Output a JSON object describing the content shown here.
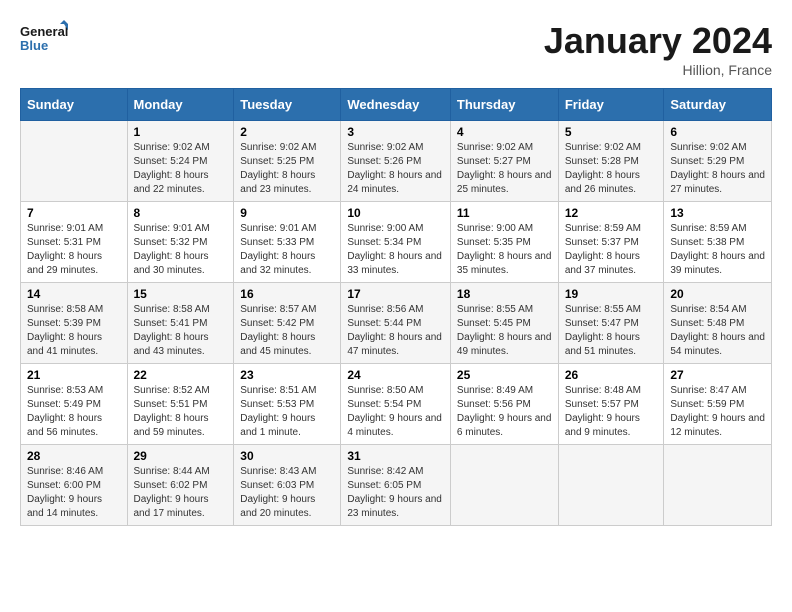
{
  "header": {
    "logo_line1": "General",
    "logo_line2": "Blue",
    "month": "January 2024",
    "location": "Hillion, France"
  },
  "days_of_week": [
    "Sunday",
    "Monday",
    "Tuesday",
    "Wednesday",
    "Thursday",
    "Friday",
    "Saturday"
  ],
  "weeks": [
    [
      {
        "day": "",
        "sunrise": "",
        "sunset": "",
        "daylight": ""
      },
      {
        "day": "1",
        "sunrise": "Sunrise: 9:02 AM",
        "sunset": "Sunset: 5:24 PM",
        "daylight": "Daylight: 8 hours and 22 minutes."
      },
      {
        "day": "2",
        "sunrise": "Sunrise: 9:02 AM",
        "sunset": "Sunset: 5:25 PM",
        "daylight": "Daylight: 8 hours and 23 minutes."
      },
      {
        "day": "3",
        "sunrise": "Sunrise: 9:02 AM",
        "sunset": "Sunset: 5:26 PM",
        "daylight": "Daylight: 8 hours and 24 minutes."
      },
      {
        "day": "4",
        "sunrise": "Sunrise: 9:02 AM",
        "sunset": "Sunset: 5:27 PM",
        "daylight": "Daylight: 8 hours and 25 minutes."
      },
      {
        "day": "5",
        "sunrise": "Sunrise: 9:02 AM",
        "sunset": "Sunset: 5:28 PM",
        "daylight": "Daylight: 8 hours and 26 minutes."
      },
      {
        "day": "6",
        "sunrise": "Sunrise: 9:02 AM",
        "sunset": "Sunset: 5:29 PM",
        "daylight": "Daylight: 8 hours and 27 minutes."
      }
    ],
    [
      {
        "day": "7",
        "sunrise": "Sunrise: 9:01 AM",
        "sunset": "Sunset: 5:31 PM",
        "daylight": "Daylight: 8 hours and 29 minutes."
      },
      {
        "day": "8",
        "sunrise": "Sunrise: 9:01 AM",
        "sunset": "Sunset: 5:32 PM",
        "daylight": "Daylight: 8 hours and 30 minutes."
      },
      {
        "day": "9",
        "sunrise": "Sunrise: 9:01 AM",
        "sunset": "Sunset: 5:33 PM",
        "daylight": "Daylight: 8 hours and 32 minutes."
      },
      {
        "day": "10",
        "sunrise": "Sunrise: 9:00 AM",
        "sunset": "Sunset: 5:34 PM",
        "daylight": "Daylight: 8 hours and 33 minutes."
      },
      {
        "day": "11",
        "sunrise": "Sunrise: 9:00 AM",
        "sunset": "Sunset: 5:35 PM",
        "daylight": "Daylight: 8 hours and 35 minutes."
      },
      {
        "day": "12",
        "sunrise": "Sunrise: 8:59 AM",
        "sunset": "Sunset: 5:37 PM",
        "daylight": "Daylight: 8 hours and 37 minutes."
      },
      {
        "day": "13",
        "sunrise": "Sunrise: 8:59 AM",
        "sunset": "Sunset: 5:38 PM",
        "daylight": "Daylight: 8 hours and 39 minutes."
      }
    ],
    [
      {
        "day": "14",
        "sunrise": "Sunrise: 8:58 AM",
        "sunset": "Sunset: 5:39 PM",
        "daylight": "Daylight: 8 hours and 41 minutes."
      },
      {
        "day": "15",
        "sunrise": "Sunrise: 8:58 AM",
        "sunset": "Sunset: 5:41 PM",
        "daylight": "Daylight: 8 hours and 43 minutes."
      },
      {
        "day": "16",
        "sunrise": "Sunrise: 8:57 AM",
        "sunset": "Sunset: 5:42 PM",
        "daylight": "Daylight: 8 hours and 45 minutes."
      },
      {
        "day": "17",
        "sunrise": "Sunrise: 8:56 AM",
        "sunset": "Sunset: 5:44 PM",
        "daylight": "Daylight: 8 hours and 47 minutes."
      },
      {
        "day": "18",
        "sunrise": "Sunrise: 8:55 AM",
        "sunset": "Sunset: 5:45 PM",
        "daylight": "Daylight: 8 hours and 49 minutes."
      },
      {
        "day": "19",
        "sunrise": "Sunrise: 8:55 AM",
        "sunset": "Sunset: 5:47 PM",
        "daylight": "Daylight: 8 hours and 51 minutes."
      },
      {
        "day": "20",
        "sunrise": "Sunrise: 8:54 AM",
        "sunset": "Sunset: 5:48 PM",
        "daylight": "Daylight: 8 hours and 54 minutes."
      }
    ],
    [
      {
        "day": "21",
        "sunrise": "Sunrise: 8:53 AM",
        "sunset": "Sunset: 5:49 PM",
        "daylight": "Daylight: 8 hours and 56 minutes."
      },
      {
        "day": "22",
        "sunrise": "Sunrise: 8:52 AM",
        "sunset": "Sunset: 5:51 PM",
        "daylight": "Daylight: 8 hours and 59 minutes."
      },
      {
        "day": "23",
        "sunrise": "Sunrise: 8:51 AM",
        "sunset": "Sunset: 5:53 PM",
        "daylight": "Daylight: 9 hours and 1 minute."
      },
      {
        "day": "24",
        "sunrise": "Sunrise: 8:50 AM",
        "sunset": "Sunset: 5:54 PM",
        "daylight": "Daylight: 9 hours and 4 minutes."
      },
      {
        "day": "25",
        "sunrise": "Sunrise: 8:49 AM",
        "sunset": "Sunset: 5:56 PM",
        "daylight": "Daylight: 9 hours and 6 minutes."
      },
      {
        "day": "26",
        "sunrise": "Sunrise: 8:48 AM",
        "sunset": "Sunset: 5:57 PM",
        "daylight": "Daylight: 9 hours and 9 minutes."
      },
      {
        "day": "27",
        "sunrise": "Sunrise: 8:47 AM",
        "sunset": "Sunset: 5:59 PM",
        "daylight": "Daylight: 9 hours and 12 minutes."
      }
    ],
    [
      {
        "day": "28",
        "sunrise": "Sunrise: 8:46 AM",
        "sunset": "Sunset: 6:00 PM",
        "daylight": "Daylight: 9 hours and 14 minutes."
      },
      {
        "day": "29",
        "sunrise": "Sunrise: 8:44 AM",
        "sunset": "Sunset: 6:02 PM",
        "daylight": "Daylight: 9 hours and 17 minutes."
      },
      {
        "day": "30",
        "sunrise": "Sunrise: 8:43 AM",
        "sunset": "Sunset: 6:03 PM",
        "daylight": "Daylight: 9 hours and 20 minutes."
      },
      {
        "day": "31",
        "sunrise": "Sunrise: 8:42 AM",
        "sunset": "Sunset: 6:05 PM",
        "daylight": "Daylight: 9 hours and 23 minutes."
      },
      {
        "day": "",
        "sunrise": "",
        "sunset": "",
        "daylight": ""
      },
      {
        "day": "",
        "sunrise": "",
        "sunset": "",
        "daylight": ""
      },
      {
        "day": "",
        "sunrise": "",
        "sunset": "",
        "daylight": ""
      }
    ]
  ]
}
